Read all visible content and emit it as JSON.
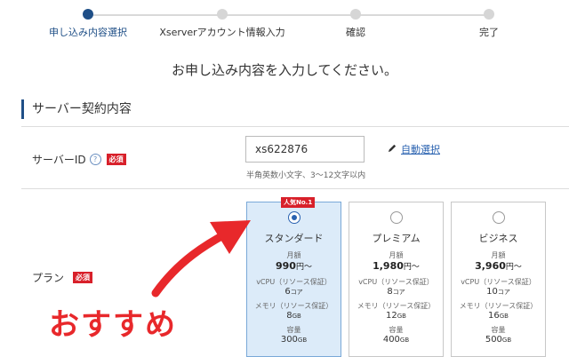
{
  "stepper": {
    "steps": [
      {
        "label": "申し込み内容選択",
        "active": true
      },
      {
        "label": "Xserverアカウント情報入力",
        "active": false
      },
      {
        "label": "確認",
        "active": false
      },
      {
        "label": "完了",
        "active": false
      }
    ]
  },
  "headline": "お申し込み内容を入力してください。",
  "section": {
    "title": "サーバー契約内容"
  },
  "server_id": {
    "label": "サーバーID",
    "help_icon": "?",
    "required": "必須",
    "value": "xs622876",
    "hint": "半角英数小文字、3〜12文字以内",
    "auto_select": "自動選択"
  },
  "plan": {
    "label": "プラン",
    "required": "必須",
    "options": [
      {
        "name": "スタンダード",
        "badge": "人気No.1",
        "monthly_label": "月額",
        "price": "990",
        "price_unit": "円〜",
        "vcpu_label": "vCPU（リソース保証）",
        "vcpu": "6",
        "vcpu_unit": "コア",
        "mem_label": "メモリ（リソース保証）",
        "mem": "8",
        "mem_unit": "GB",
        "cap_label": "容量",
        "cap": "300",
        "cap_unit": "GB",
        "selected": true
      },
      {
        "name": "プレミアム",
        "monthly_label": "月額",
        "price": "1,980",
        "price_unit": "円〜",
        "vcpu_label": "vCPU（リソース保証）",
        "vcpu": "8",
        "vcpu_unit": "コア",
        "mem_label": "メモリ（リソース保証）",
        "mem": "12",
        "mem_unit": "GB",
        "cap_label": "容量",
        "cap": "400",
        "cap_unit": "GB",
        "selected": false
      },
      {
        "name": "ビジネス",
        "monthly_label": "月額",
        "price": "3,960",
        "price_unit": "円〜",
        "vcpu_label": "vCPU（リソース保証）",
        "vcpu": "10",
        "vcpu_unit": "コア",
        "mem_label": "メモリ（リソース保証）",
        "mem": "16",
        "mem_unit": "GB",
        "cap_label": "容量",
        "cap": "500",
        "cap_unit": "GB",
        "selected": false
      }
    ]
  },
  "annotation": {
    "text": "おすすめ",
    "color": "#e8282b"
  },
  "colors": {
    "accent": "#1f4f87",
    "required": "#d8202a",
    "link": "#2a62b0",
    "selected_bg": "#dcebf9"
  }
}
